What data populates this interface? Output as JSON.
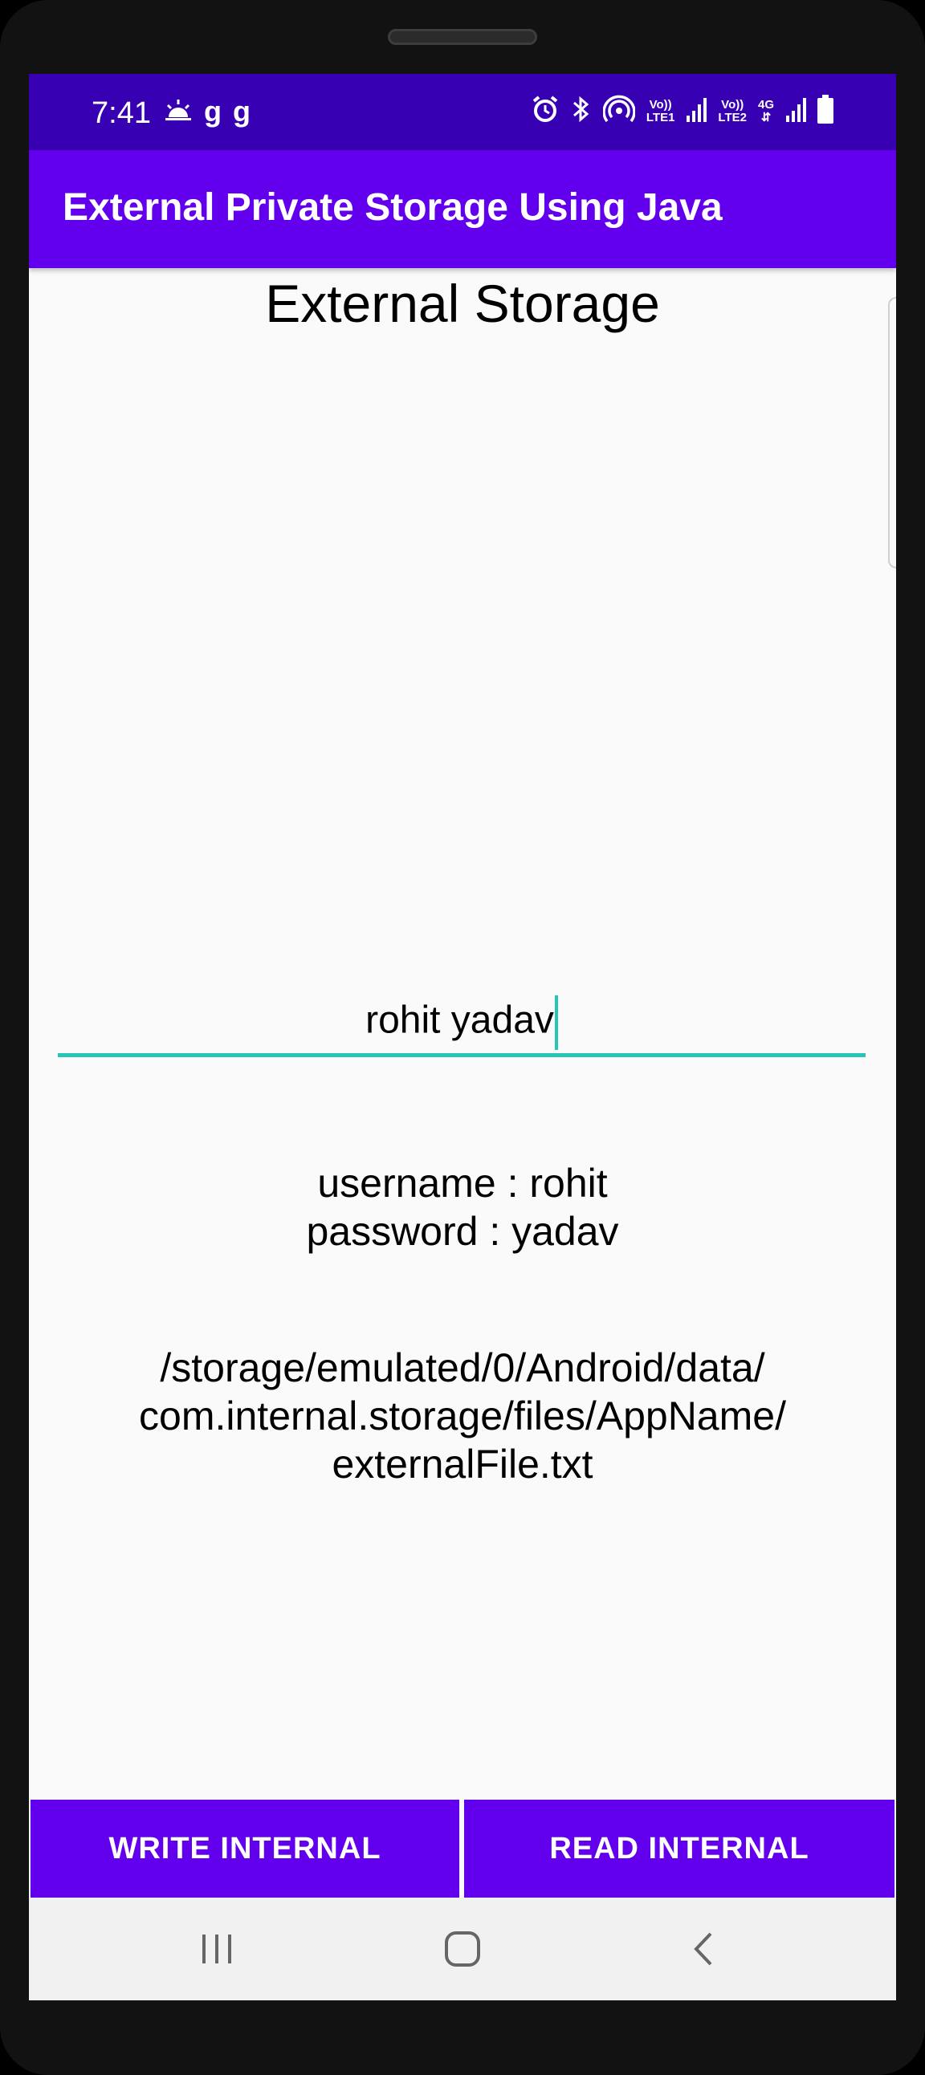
{
  "status_bar": {
    "time": "7:41",
    "left_icons": [
      "weather-icon",
      "g-app-icon",
      "g-app-icon"
    ],
    "right_icons": [
      "alarm-icon",
      "bluetooth-icon",
      "hotspot-icon",
      "volte1-icon",
      "signal-icon",
      "volte2-icon",
      "4g-icon",
      "signal-icon",
      "battery-icon"
    ],
    "volte1_label": "Vo))\nLTE1",
    "volte2_label": "Vo))\nLTE2",
    "net_label": "4G"
  },
  "app_bar": {
    "title": "External Private Storage Using Java"
  },
  "main": {
    "heading": "External Storage",
    "input_value": "rohit yadav",
    "credentials_line1": "username : rohit",
    "credentials_line2": "password : yadav",
    "path_line1": "/storage/emulated/0/Android/data/",
    "path_line2": "com.internal.storage/files/AppName/",
    "path_line3": "externalFile.txt"
  },
  "buttons": {
    "write_label": "WRITE INTERNAL",
    "read_label": "READ INTERNAL"
  },
  "nav_bar": {
    "icons": [
      "recent-apps-icon",
      "home-icon",
      "back-icon"
    ]
  },
  "colors": {
    "status_bar": "#3700b3",
    "app_bar": "#6200ee",
    "accent": "#26c6b5",
    "background": "#fafafa"
  }
}
